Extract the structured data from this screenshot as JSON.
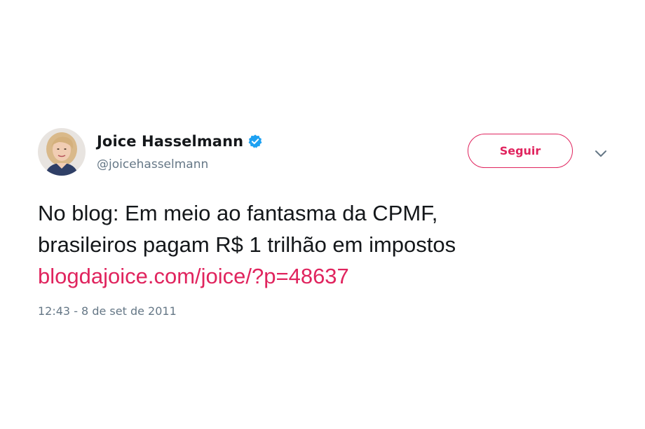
{
  "author": {
    "name": "Joice Hasselmann",
    "handle": "@joicehasselmann",
    "verified": true,
    "avatar_icon": "profile-photo"
  },
  "actions": {
    "follow_label": "Seguir",
    "menu_icon": "chevron-down-icon"
  },
  "tweet": {
    "text_line_1": "No blog: Em meio ao fantasma da CPMF,",
    "text_line_2": "brasileiros pagam R$ 1 trilhão em impostos",
    "link": "blogdajoice.com/joice/?p=48637",
    "timestamp": "12:43 - 8 de set de 2011"
  },
  "colors": {
    "accent": "#e0245e",
    "verified": "#1da1f2",
    "secondary_text": "#657786",
    "primary_text": "#14171a"
  }
}
